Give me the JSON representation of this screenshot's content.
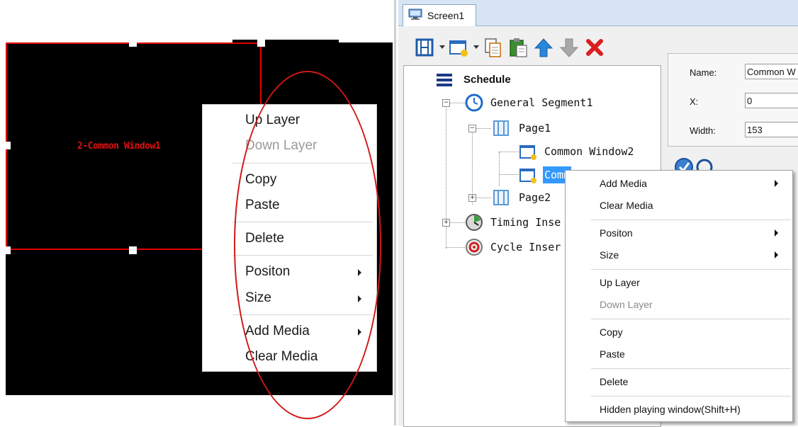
{
  "left_canvas": {
    "window_label": "2-Common Window1"
  },
  "left_menu": {
    "items": [
      {
        "label": "Up Layer",
        "enabled": true,
        "submenu": false
      },
      {
        "label": "Down Layer",
        "enabled": false,
        "submenu": false
      },
      {
        "label": "Copy",
        "enabled": true,
        "submenu": false
      },
      {
        "label": "Paste",
        "enabled": true,
        "submenu": false
      },
      {
        "label": "Delete",
        "enabled": true,
        "submenu": false
      },
      {
        "label": "Positon",
        "enabled": true,
        "submenu": true
      },
      {
        "label": "Size",
        "enabled": true,
        "submenu": true
      },
      {
        "label": "Add Media",
        "enabled": true,
        "submenu": true
      },
      {
        "label": "Clear Media",
        "enabled": true,
        "submenu": false
      }
    ]
  },
  "app": {
    "tab": {
      "label": "Screen1",
      "icon": "monitor-icon"
    },
    "toolbar": [
      {
        "name": "add-page-button",
        "icon": "film-strip-icon"
      },
      {
        "name": "add-window-button",
        "icon": "window-add-icon"
      },
      {
        "name": "copy-button",
        "icon": "copy-icon"
      },
      {
        "name": "paste-button",
        "icon": "paste-icon"
      },
      {
        "name": "move-up-button",
        "icon": "arrow-up-icon"
      },
      {
        "name": "move-down-button",
        "icon": "arrow-down-icon"
      },
      {
        "name": "delete-button",
        "icon": "red-x-icon"
      }
    ],
    "tree": {
      "root": "Schedule",
      "segment": "General Segment1",
      "page1": "Page1",
      "window2": "Common Window2",
      "window1_visible": "Comm",
      "page2": "Page2",
      "timing": "Timing Inse",
      "cycle": "Cycle Inser"
    },
    "props": {
      "name_label": "Name:",
      "name_value": "Common W",
      "x_label": "X:",
      "x_value": "0",
      "width_label": "Width:",
      "width_value": "153"
    }
  },
  "right_menu": {
    "items": [
      {
        "label": "Add Media",
        "enabled": true,
        "submenu": true
      },
      {
        "label": "Clear Media",
        "enabled": true,
        "submenu": false
      },
      {
        "label": "Positon",
        "enabled": true,
        "submenu": true
      },
      {
        "label": "Size",
        "enabled": true,
        "submenu": true
      },
      {
        "label": "Up Layer",
        "enabled": true,
        "submenu": false
      },
      {
        "label": "Down Layer",
        "enabled": false,
        "submenu": false
      },
      {
        "label": "Copy",
        "enabled": true,
        "submenu": false
      },
      {
        "label": "Paste",
        "enabled": true,
        "submenu": false
      },
      {
        "label": "Delete",
        "enabled": true,
        "submenu": false
      },
      {
        "label": "Hidden playing window(Shift+H)",
        "enabled": true,
        "submenu": false
      }
    ]
  },
  "colors": {
    "window_border": "#e00000",
    "annotation_ellipse": "#d01818",
    "selection": "#3399ff"
  }
}
